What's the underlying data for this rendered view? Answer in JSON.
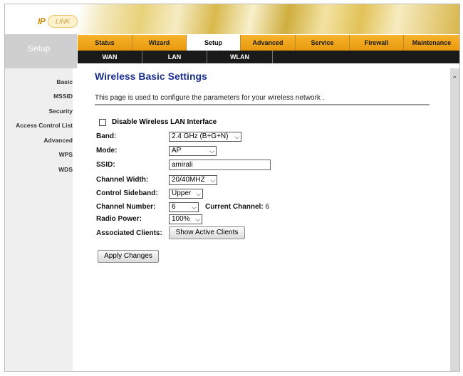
{
  "header": {
    "logo_ip": "IP",
    "logo_link": "LINK",
    "section_label": "Setup"
  },
  "menu": {
    "tabs": [
      {
        "label": "Status"
      },
      {
        "label": "Wizard"
      },
      {
        "label": "Setup",
        "active": true
      },
      {
        "label": "Advanced"
      },
      {
        "label": "Service"
      },
      {
        "label": "Firewall"
      },
      {
        "label": "Maintenance"
      }
    ]
  },
  "submenu": {
    "tabs": [
      {
        "label": "WAN"
      },
      {
        "label": "LAN"
      },
      {
        "label": "WLAN",
        "active": true
      }
    ]
  },
  "sidebar": {
    "items": [
      {
        "label": "Basic"
      },
      {
        "label": "MSSID"
      },
      {
        "label": "Security"
      },
      {
        "label": "Access Control List"
      },
      {
        "label": "Advanced"
      },
      {
        "label": "WPS"
      },
      {
        "label": "WDS"
      }
    ]
  },
  "content": {
    "title": "Wireless Basic Settings",
    "description": "This page is used to configure the parameters for your wireless network .",
    "disable_label": "Disable Wireless LAN Interface",
    "band_label": "Band:",
    "band_value": "2.4 GHz (B+G+N)",
    "mode_label": "Mode:",
    "mode_value": "AP",
    "ssid_label": "SSID:",
    "ssid_value": "amirali",
    "channel_width_label": "Channel Width:",
    "channel_width_value": "20/40MHZ",
    "sideband_label": "Control Sideband:",
    "sideband_value": "Upper",
    "channel_number_label": "Channel Number:",
    "channel_number_value": "6",
    "current_channel_label": "Current Channel:",
    "current_channel_value": "6",
    "radio_power_label": "Radio Power:",
    "radio_power_value": "100%",
    "assoc_label": "Associated Clients:",
    "show_clients_button": "Show Active Clients",
    "apply_button": "Apply Changes"
  },
  "icons": {
    "dropdown": "chevron-down-icon",
    "scroll_up": "chevron-up-icon"
  }
}
